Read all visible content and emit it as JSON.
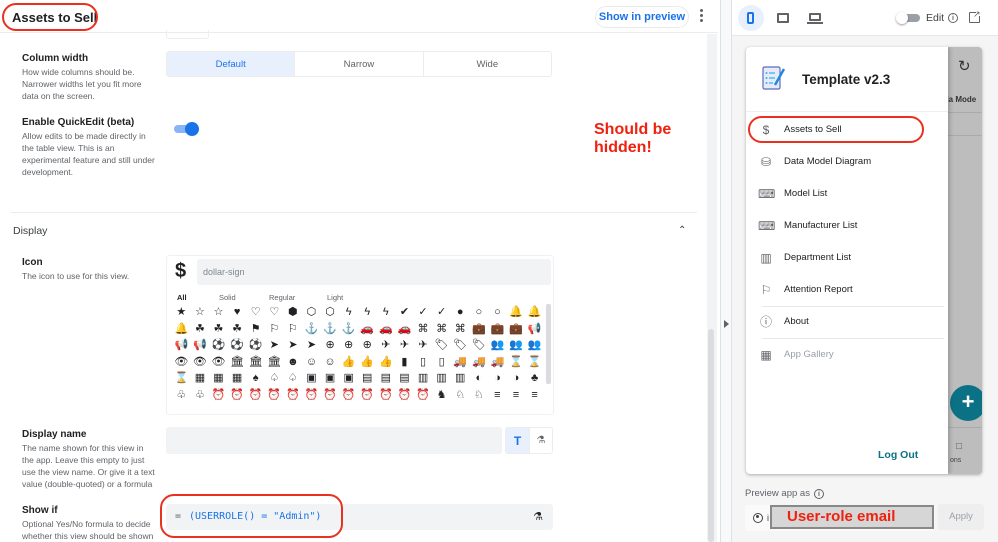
{
  "header": {
    "view_title": "Assets to Sell",
    "show_in_preview": "Show in preview"
  },
  "settings": {
    "column_width": {
      "label": "Column width",
      "description": "How wide columns should be. Narrower widths let you fit more data on the screen.",
      "options": [
        "Default",
        "Narrow",
        "Wide"
      ],
      "selected": "Default"
    },
    "quickedit": {
      "label": "Enable QuickEdit (beta)",
      "description": "Allow edits to be made directly in the table view. This is an experimental feature and still under development.",
      "enabled": true
    }
  },
  "display": {
    "section_title": "Display",
    "icon": {
      "label": "Icon",
      "description": "The icon to use for this view.",
      "current_glyph": "$",
      "search_value": "dollar-sign",
      "tabs": [
        "All",
        "Solid",
        "Regular",
        "Light"
      ],
      "active_tab": "All",
      "grid": [
        "★",
        "☆",
        "☆",
        "♥",
        "♡",
        "♡",
        "⬢",
        "⬡",
        "⬡",
        "ϟ",
        "ϟ",
        "ϟ",
        "✔",
        "✓",
        "✓",
        "●",
        "○",
        "○",
        "🔔",
        "🔔",
        "🔔",
        "☘",
        "☘",
        "☘",
        "⚑",
        "⚐",
        "⚐",
        "⚓",
        "⚓",
        "⚓",
        "🚗",
        "🚗",
        "🚗",
        "⌘",
        "⌘",
        "⌘",
        "💼",
        "💼",
        "💼",
        "📢",
        "📢",
        "📢",
        "⚽",
        "⚽",
        "⚽",
        "➤",
        "➤",
        "➤",
        "⊕",
        "⊕",
        "⊕",
        "✈",
        "✈",
        "✈",
        "🏷",
        "🏷",
        "🏷",
        "👥",
        "👥",
        "👥",
        "👁",
        "👁",
        "👁",
        "🏛",
        "🏛",
        "🏛",
        "☻",
        "☺",
        "☺",
        "👍",
        "👍",
        "👍",
        "▮",
        "▯",
        "▯",
        "🚚",
        "🚚",
        "🚚",
        "⌛",
        "⌛",
        "⌛",
        "▦",
        "▦",
        "▦",
        "♠",
        "♤",
        "♤",
        "▣",
        "▣",
        "▣",
        "▤",
        "▤",
        "▤",
        "▥",
        "▥",
        "▥",
        "◐",
        "◑",
        "◑",
        "♣",
        "♧",
        "♧",
        "⏰",
        "⏰",
        "⏰",
        "⏰",
        "⏰",
        "⏰",
        "⏰",
        "⏰",
        "⏰",
        "⏰",
        "⏰",
        "⏰",
        "♞",
        "♘",
        "♘",
        "≡",
        "≡",
        "≡"
      ]
    },
    "display_name": {
      "label": "Display name",
      "description": "The name shown for this view in the app. Leave this empty to just use the view name. Or give it a text value (double-quoted) or a formula",
      "value": "",
      "text_mode_glyph": "T",
      "formula_glyph": "⚗"
    },
    "show_if": {
      "label": "Show if",
      "description": "Optional Yes/No formula to decide whether this view should be shown",
      "eq": "=",
      "formula": "(USERROLE() = \"Admin\")",
      "formula_glyph": "⚗"
    }
  },
  "annotations": {
    "should_be_hidden": "Should be hidden!",
    "user_role_email": "User-role email"
  },
  "preview": {
    "edit_label": "Edit",
    "edit_enabled": false,
    "device_selected": "phone",
    "app_name": "Template v2.3",
    "behind_text": "via Mode",
    "behind_tab_label": "ons",
    "menu": [
      {
        "label": "Assets to Sell",
        "icon": "$"
      },
      {
        "label": "Data Model Diagram",
        "icon": "⛁"
      },
      {
        "label": "Model List",
        "icon": "⌨"
      },
      {
        "label": "Manufacturer List",
        "icon": "⌨"
      },
      {
        "label": "Department List",
        "icon": "▥"
      },
      {
        "label": "Attention Report",
        "icon": "⚐"
      },
      {
        "label": "About",
        "icon": "ⓘ"
      },
      {
        "label": "App Gallery",
        "icon": "▦"
      }
    ],
    "logout": "Log Out",
    "preview_as_label": "Preview app as",
    "user_prefix": "i",
    "apply": "Apply"
  }
}
